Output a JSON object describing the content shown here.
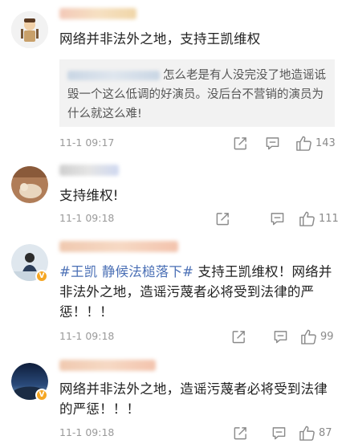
{
  "comments": [
    {
      "text": "网络并非法外之地，支持王凯维权",
      "quote": {
        "text": "怎么老是有人没完没了地造谣诋毁一个这么低调的好演员。没后台不营销的演员为什么就这么难!"
      },
      "time": "11-1 09:17",
      "likes": "143"
    },
    {
      "text": "支持维权!",
      "time": "11-1 09:18",
      "likes": "111"
    },
    {
      "hashtag": "#王凯 静候法槌落下#",
      "text": " 支持王凯维权！网络并非法外之地，造谣污蔑者必将受到法律的严惩！！！",
      "time": "11-1 09:18",
      "likes": "99"
    },
    {
      "text": "网络并非法外之地，造谣污蔑者必将受到法律的严惩！！！",
      "time": "11-1 09:18",
      "likes": "87"
    }
  ],
  "icons": [
    "share-icon",
    "comment-icon",
    "like-icon"
  ],
  "colors": {
    "hashtag": "#4a6fb5",
    "meta": "#9a9a9a",
    "quote_bg": "#f2f2f2",
    "vbadge": "#f5a623"
  }
}
